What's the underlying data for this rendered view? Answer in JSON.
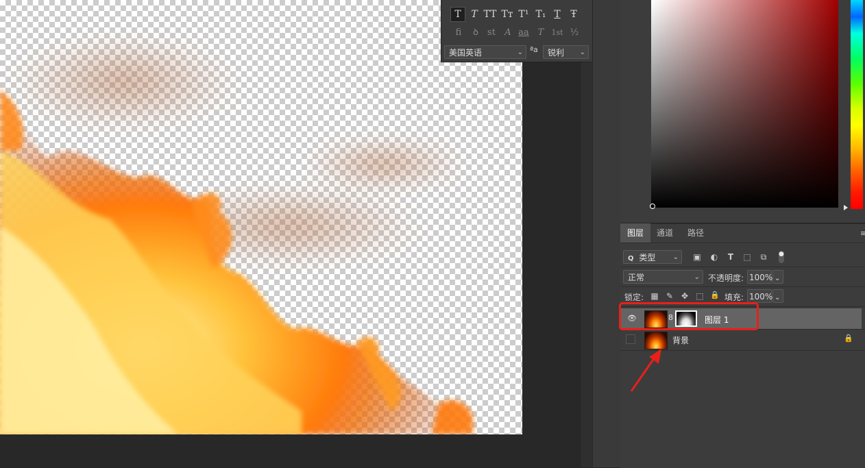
{
  "character_panel": {
    "type_style_glyphs": [
      "T",
      "T",
      "TT",
      "Tт",
      "T¹",
      "T₁",
      "T",
      "Ŧ"
    ],
    "opentype_glyphs": [
      "fi",
      "ꝺ",
      "st",
      "A",
      "aa",
      "T",
      "1st",
      "½"
    ],
    "language": "美国英语",
    "aa_prefix": "ªa",
    "antialias": "锐利"
  },
  "layers_panel": {
    "tabs": [
      "图层",
      "通道",
      "路径"
    ],
    "filter_kind": "类型",
    "blend_mode": "正常",
    "opacity_label": "不透明度:",
    "opacity_value": "100%",
    "lock_label": "锁定:",
    "fill_label": "填充:",
    "fill_value": "100%",
    "menu_glyph": "≡",
    "layers": [
      {
        "name": "图层 1",
        "visible": true,
        "has_mask": true,
        "selected": true
      },
      {
        "name": "背景",
        "visible": false,
        "locked": true
      }
    ]
  },
  "icons": {
    "search": "Q",
    "image_filter": "▣",
    "adjust_filter": "◐",
    "type_filter": "T",
    "shape_filter": "⬚",
    "smart_filter": "⧉",
    "toggle": "●",
    "dropdown": "⌄",
    "eye": "👁",
    "chain": "8",
    "lock": "🔒",
    "lock_pixels": "▦",
    "lock_brush": "✎",
    "lock_move": "✥",
    "lock_artboard": "⬚"
  },
  "annotation": {
    "highlight_color": "#e8201a",
    "arrow_color": "#e8201a"
  }
}
